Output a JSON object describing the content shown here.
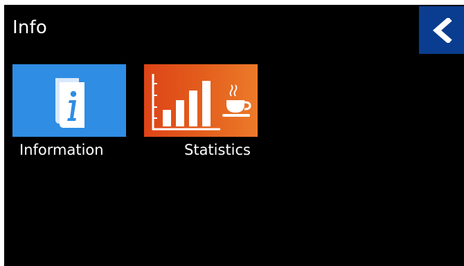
{
  "header": {
    "title": "Info",
    "back_icon": "chevron-left-icon",
    "back_color": "#0a3d8f"
  },
  "tiles": [
    {
      "label": "Information",
      "icon": "info-book-icon",
      "color": "#2f8de4"
    },
    {
      "label": "Statistics",
      "icon": "bar-chart-coffee-icon",
      "color": "#e35d1c"
    }
  ]
}
